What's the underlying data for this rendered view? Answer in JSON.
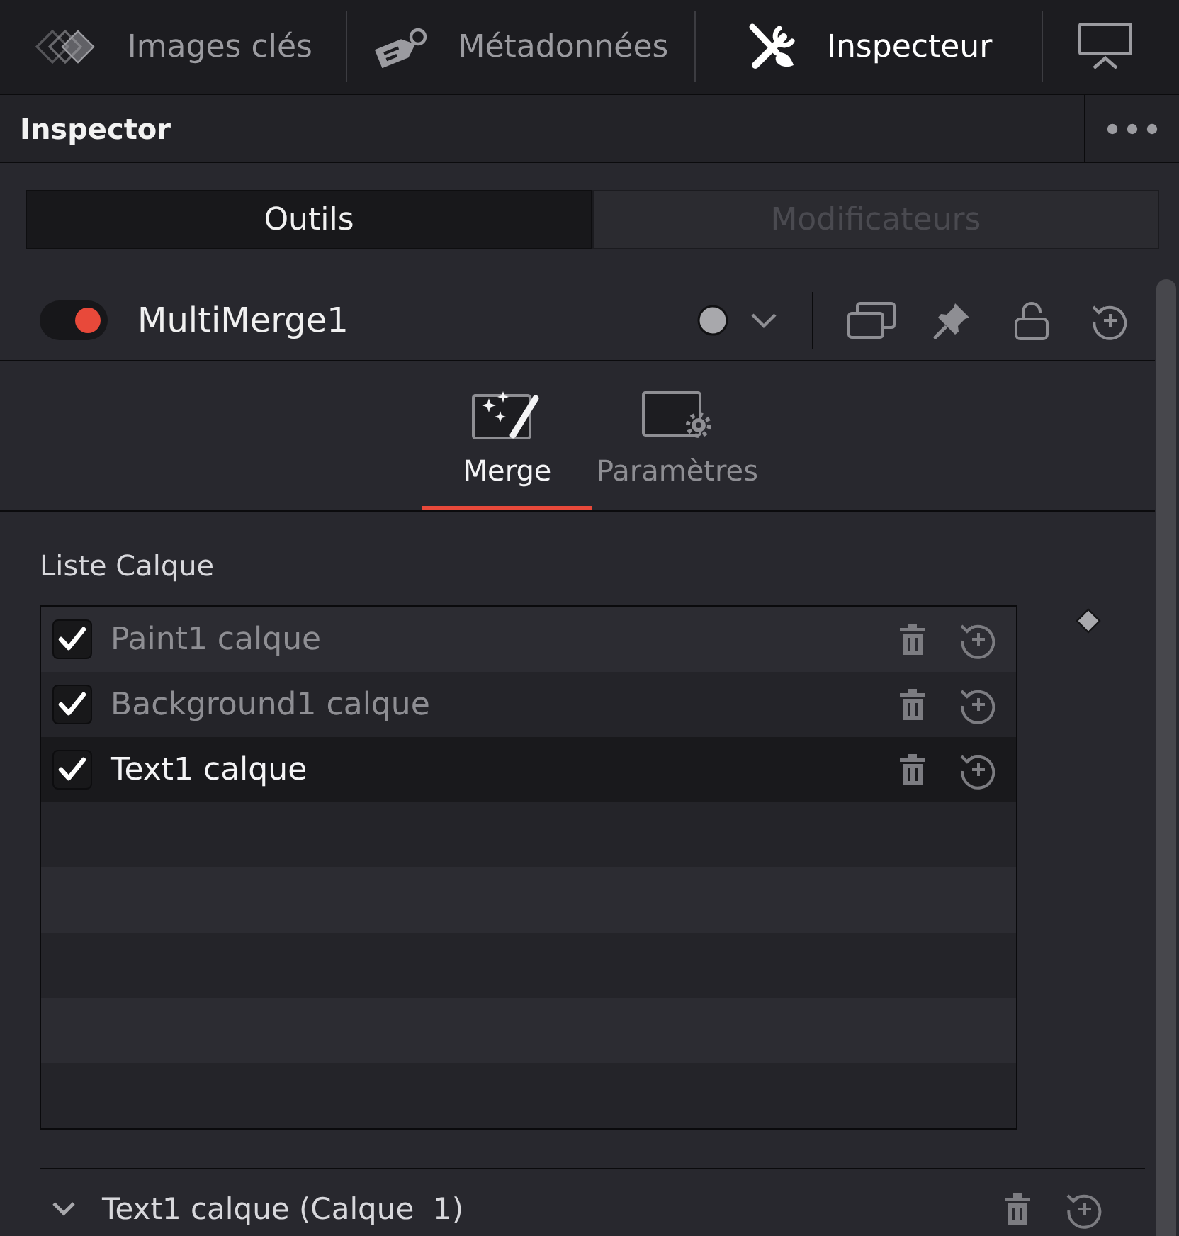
{
  "top_tabs": [
    {
      "label": "Images clés",
      "kind": "keyframes",
      "selected": false
    },
    {
      "label": "Métadonnées",
      "kind": "metadata",
      "selected": false
    },
    {
      "label": "Inspecteur",
      "kind": "inspector",
      "selected": true
    }
  ],
  "panel": {
    "title": "Inspector"
  },
  "mode_tabs": [
    {
      "label": "Outils",
      "selected": true,
      "disabled": false
    },
    {
      "label": "Modificateurs",
      "selected": false,
      "disabled": true
    }
  ],
  "node": {
    "name": "MultiMerge1",
    "enabled": true
  },
  "sub_tabs": [
    {
      "label": "Merge",
      "kind": "merge",
      "selected": true
    },
    {
      "label": "Paramètres",
      "kind": "settings",
      "selected": false
    }
  ],
  "layer_list": {
    "label": "Liste Calque",
    "layers": [
      {
        "name": "Paint1 calque",
        "checked": true,
        "selected": false
      },
      {
        "name": "Background1 calque",
        "checked": true,
        "selected": false
      },
      {
        "name": "Text1 calque",
        "checked": true,
        "selected": true
      }
    ]
  },
  "layer_section": {
    "title": "Text1 calque (Calque  1)",
    "expanded": true
  }
}
